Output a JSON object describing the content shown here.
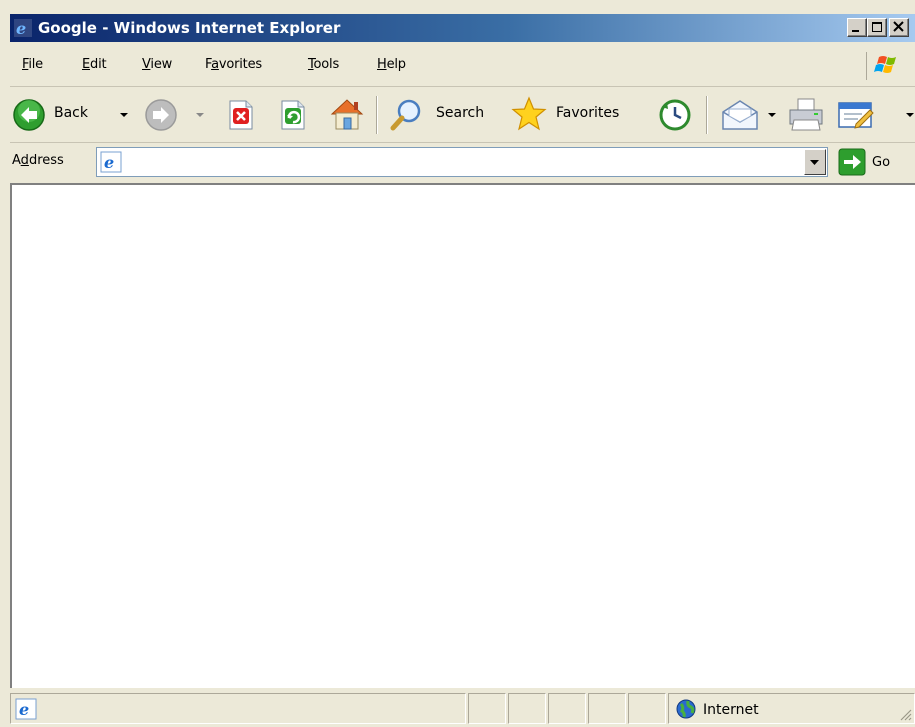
{
  "window": {
    "title": "Google - Windows Internet Explorer"
  },
  "menu": {
    "items": [
      {
        "label": "File",
        "accel": "F"
      },
      {
        "label": "Edit",
        "accel": "E"
      },
      {
        "label": "View",
        "accel": "V"
      },
      {
        "label": "Favorites",
        "accel": "a"
      },
      {
        "label": "Tools",
        "accel": "T"
      },
      {
        "label": "Help",
        "accel": "H"
      }
    ]
  },
  "toolbar": {
    "back_label": "Back",
    "search_label": "Search",
    "favorites_label": "Favorites",
    "icons": [
      "back-icon",
      "forward-icon",
      "stop-icon",
      "refresh-icon",
      "home-icon",
      "search-icon",
      "favorites-star-icon",
      "history-icon",
      "mail-icon",
      "print-icon",
      "edit-icon"
    ]
  },
  "address": {
    "label": "Address",
    "value": "",
    "go_label": "Go"
  },
  "status": {
    "text": "",
    "zone": "Internet"
  },
  "colors": {
    "titlebar_start": "#0a246a",
    "titlebar_end": "#a6caf0",
    "chrome": "#ece9d8",
    "content": "#ffffff"
  }
}
